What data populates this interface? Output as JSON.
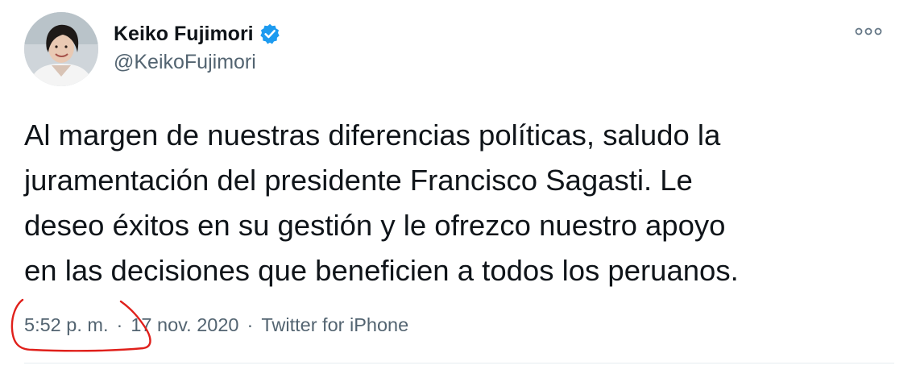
{
  "author": {
    "display_name": "Keiko Fujimori",
    "handle": "@KeikoFujimori",
    "verified": true
  },
  "icons": {
    "verified": "verified-badge-icon",
    "more": "more-options-icon"
  },
  "tweet": {
    "text_lines": [
      "Al margen de nuestras diferencias políticas, saludo la",
      "juramentación del presidente Francisco Sagasti. Le",
      "deseo éxitos en su gestión y le ofrezco nuestro apoyo",
      "en las decisiones que beneficien a todos los peruanos."
    ],
    "time": "5:52 p. m.",
    "separator": "·",
    "date": "17 nov. 2020",
    "source": "Twitter for iPhone"
  },
  "colors": {
    "verified_blue": "#1d9bf0",
    "text_primary": "#0f1419",
    "text_secondary": "#536471",
    "annotation_red": "#e0201b"
  }
}
